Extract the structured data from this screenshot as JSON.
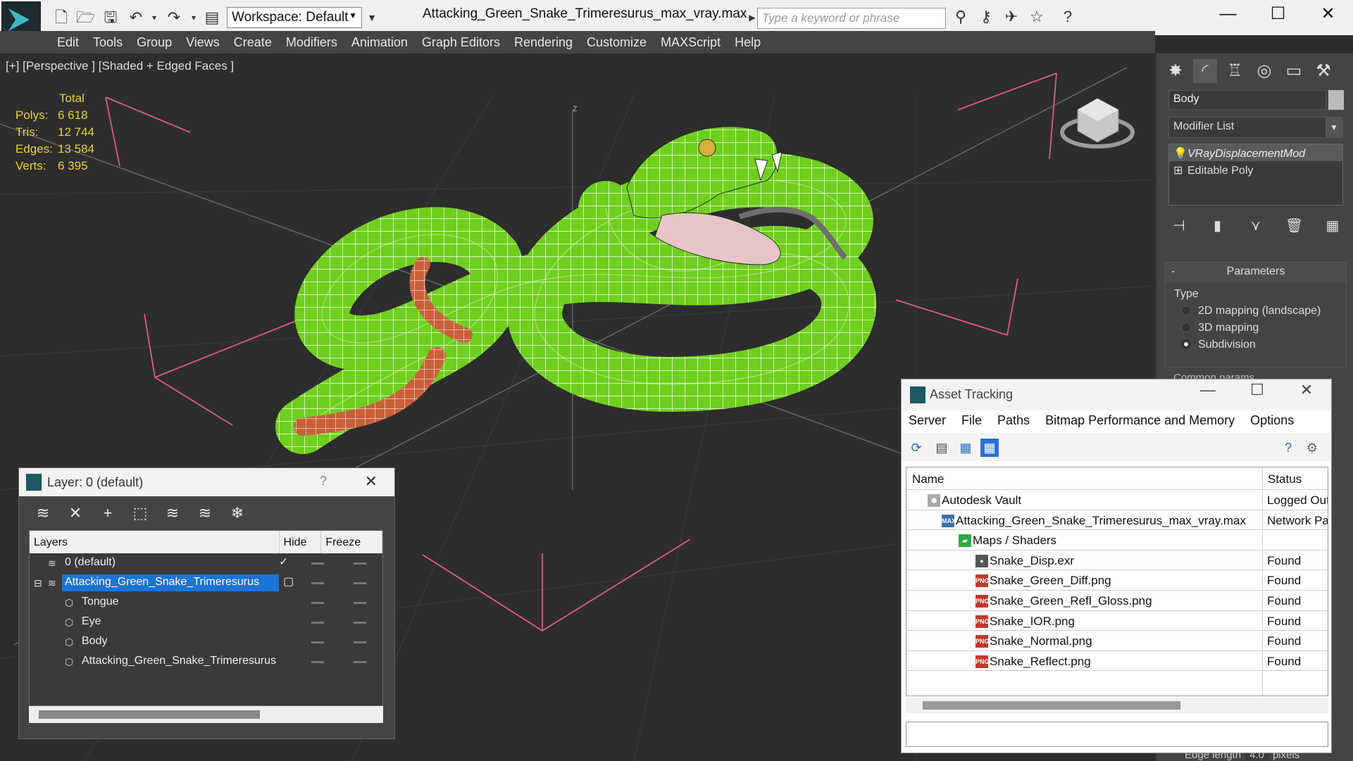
{
  "window": {
    "title": "Attacking_Green_Snake_Trimeresurus_max_vray.max",
    "workspace": "Workspace: Default",
    "search_placeholder": "Type a keyword or phrase"
  },
  "menu": [
    "Edit",
    "Tools",
    "Group",
    "Views",
    "Create",
    "Modifiers",
    "Animation",
    "Graph Editors",
    "Rendering",
    "Customize",
    "MAXScript",
    "Help"
  ],
  "viewport": {
    "label": "[+] [Perspective ] [Shaded + Edged Faces ]",
    "stats": {
      "total_label": "Total",
      "rows": [
        {
          "k": "Polys:",
          "v": "6 618"
        },
        {
          "k": "Tris:",
          "v": "12 744"
        },
        {
          "k": "Edges:",
          "v": "13 584"
        },
        {
          "k": "Verts:",
          "v": "6 395"
        }
      ]
    },
    "axis_label": "z"
  },
  "command_panel": {
    "object_name": "Body",
    "modifier_list": "Modifier List",
    "stack": [
      {
        "label": "VRayDisplacementMod",
        "selected": true
      },
      {
        "label": "Editable Poly",
        "selected": false
      }
    ],
    "params_header": "Parameters",
    "params_minus": "-",
    "type_label": "Type",
    "options": [
      {
        "label": "2D mapping (landscape)",
        "on": false
      },
      {
        "label": "3D mapping",
        "on": false
      },
      {
        "label": "Subdivision",
        "on": true
      }
    ],
    "common_params": "Common params",
    "edge_length_label": "Edge length",
    "edge_length_value": "4.0",
    "edge_length_unit": "pixels"
  },
  "layer_window": {
    "title": "Layer: 0 (default)",
    "question": "?",
    "columns": [
      "Layers",
      "Hide",
      "Freeze"
    ],
    "rows": [
      {
        "name": "0 (default)",
        "indent": 1,
        "selected": false,
        "check": "✓"
      },
      {
        "name": "Attacking_Green_Snake_Trimeresurus",
        "indent": 1,
        "selected": true,
        "check": "▢"
      },
      {
        "name": "Tongue",
        "indent": 2,
        "selected": false,
        "check": ""
      },
      {
        "name": "Eye",
        "indent": 2,
        "selected": false,
        "check": ""
      },
      {
        "name": "Body",
        "indent": 2,
        "selected": false,
        "check": ""
      },
      {
        "name": "Attacking_Green_Snake_Trimeresurus",
        "indent": 2,
        "selected": false,
        "check": ""
      }
    ]
  },
  "asset_window": {
    "title": "Asset Tracking",
    "menu": [
      "Server",
      "File",
      "Paths",
      "Bitmap Performance and Memory",
      "Options"
    ],
    "columns": [
      "Name",
      "Status"
    ],
    "rows": [
      {
        "name": "Autodesk Vault",
        "indent": 0,
        "status": "Logged Out",
        "icon": "vault"
      },
      {
        "name": "Attacking_Green_Snake_Trimeresurus_max_vray.max",
        "indent": 1,
        "status": "Network Path",
        "icon": "max"
      },
      {
        "name": "Maps / Shaders",
        "indent": 2,
        "status": "",
        "icon": "maps"
      },
      {
        "name": "Snake_Disp.exr",
        "indent": 3,
        "status": "Found",
        "icon": "exr"
      },
      {
        "name": "Snake_Green_Diff.png",
        "indent": 3,
        "status": "Found",
        "icon": "png"
      },
      {
        "name": "Snake_Green_Refl_Gloss.png",
        "indent": 3,
        "status": "Found",
        "icon": "png"
      },
      {
        "name": "Snake_IOR.png",
        "indent": 3,
        "status": "Found",
        "icon": "png"
      },
      {
        "name": "Snake_Normal.png",
        "indent": 3,
        "status": "Found",
        "icon": "png"
      },
      {
        "name": "Snake_Reflect.png",
        "indent": 3,
        "status": "Found",
        "icon": "png"
      }
    ]
  },
  "colors": {
    "stats": "#e8d23a",
    "selection": "#1a73d8",
    "snake": "#6fcf1f",
    "grid_lines": "#e05a8a"
  }
}
